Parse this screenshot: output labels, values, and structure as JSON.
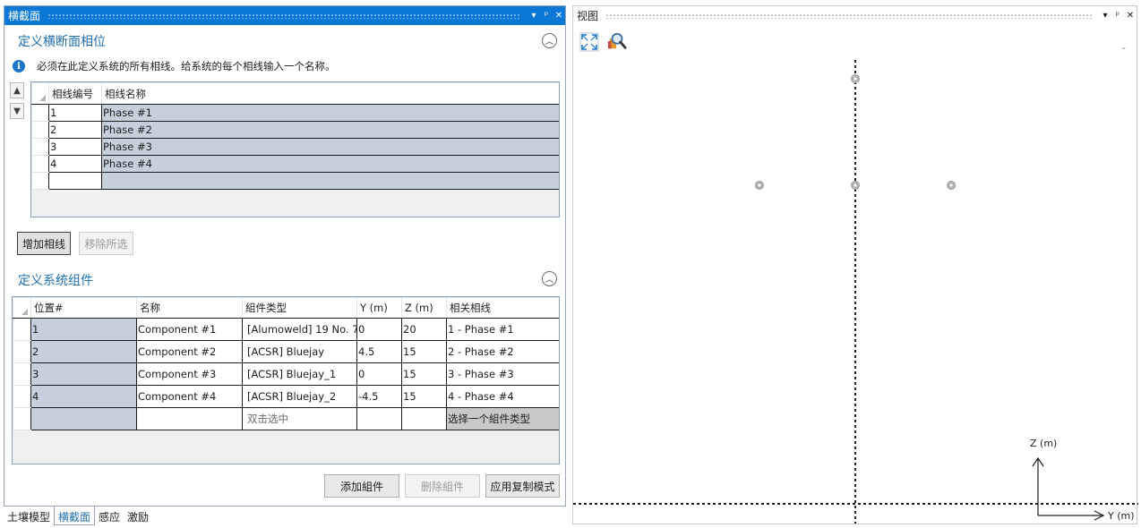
{
  "left_panel": {
    "title": "横截面",
    "title_buttons": [
      "▾",
      "ᵖ",
      "✕"
    ]
  },
  "phase_section": {
    "header": "定义横断面相位",
    "info": "必须在此定义系统的所有相线。给系统的每个相线输入一个名称。",
    "columns": [
      "相线编号",
      "相线名称"
    ],
    "rows": [
      {
        "number": "1",
        "name": "Phase #1"
      },
      {
        "number": "2",
        "name": "Phase #2"
      },
      {
        "number": "3",
        "name": "Phase #3"
      },
      {
        "number": "4",
        "name": "Phase #4"
      }
    ],
    "add_button": "增加相线",
    "remove_button": "移除所选"
  },
  "component_section": {
    "header": "定义系统组件",
    "columns": [
      "位置#",
      "名称",
      "組件类型",
      "Y (m)",
      "Z (m)",
      "相关相线"
    ],
    "rows": [
      {
        "position": "1",
        "name": "Component #1",
        "type": "[Alumoweld] 19 No. 7",
        "y": "0",
        "z": "20",
        "phase": "1 - Phase #1"
      },
      {
        "position": "2",
        "name": "Component #2",
        "type": "[ACSR] Bluejay",
        "y": "4.5",
        "z": "15",
        "phase": "2 - Phase #2"
      },
      {
        "position": "3",
        "name": "Component #3",
        "type": "[ACSR] Bluejay_1",
        "y": "0",
        "z": "15",
        "phase": "3 - Phase #3"
      },
      {
        "position": "4",
        "name": "Component #4",
        "type": "[ACSR] Bluejay_2",
        "y": "-4.5",
        "z": "15",
        "phase": "4 - Phase #4"
      }
    ],
    "new_row": {
      "type_placeholder": "双击选中",
      "phase_placeholder": "选择一个組件类型"
    },
    "add_button": "添加組件",
    "delete_button": "删除組件",
    "apply_button": "应用复制模式"
  },
  "bottom_tabs": [
    {
      "label": "土壤模型",
      "active": false
    },
    {
      "label": "横截面",
      "active": true
    },
    {
      "label": "感应",
      "active": false
    },
    {
      "label": "激励",
      "active": false
    }
  ],
  "view_panel": {
    "title": "视图",
    "title_buttons": [
      "▾",
      "ᵖ",
      "✕"
    ],
    "z_axis_label": "Z (m)",
    "y_axis_label": "Y (m)",
    "points": [
      {
        "y": 0,
        "z": 20
      },
      {
        "y": 4.5,
        "z": 15
      },
      {
        "y": 0,
        "z": 15
      },
      {
        "y": -4.5,
        "z": 15
      }
    ]
  },
  "colors": {
    "accent": "#0a78d4",
    "section_header": "#1f6fb2",
    "selected_cell": "#c6d0dd"
  }
}
